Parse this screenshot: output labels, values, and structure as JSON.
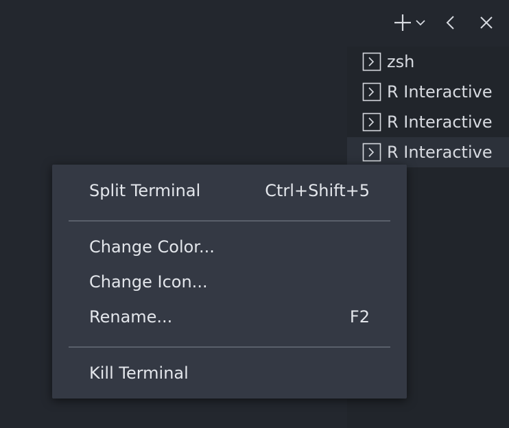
{
  "toolbar": {
    "new_terminal_icon": "plus-icon",
    "dropdown_icon": "chevron-down-icon",
    "back_icon": "chevron-left-icon",
    "close_icon": "close-icon"
  },
  "terminal_tabs": [
    {
      "label": "zsh",
      "icon": "terminal-icon",
      "active": false
    },
    {
      "label": "R Interactive",
      "icon": "terminal-icon",
      "active": false
    },
    {
      "label": "R Interactive",
      "icon": "terminal-icon",
      "active": false
    },
    {
      "label": "R Interactive",
      "icon": "terminal-icon",
      "active": true
    }
  ],
  "context_menu": {
    "split": {
      "label": "Split Terminal",
      "shortcut": "Ctrl+Shift+5"
    },
    "change_color": {
      "label": "Change Color..."
    },
    "change_icon": {
      "label": "Change Icon..."
    },
    "rename": {
      "label": "Rename...",
      "shortcut": "F2"
    },
    "kill": {
      "label": "Kill Terminal"
    }
  },
  "colors": {
    "background": "#23272e",
    "panel": "#21252b",
    "active_tab": "#2c313a",
    "menu": "#343944",
    "separator": "#5a606b",
    "text": "#d7dae0"
  }
}
